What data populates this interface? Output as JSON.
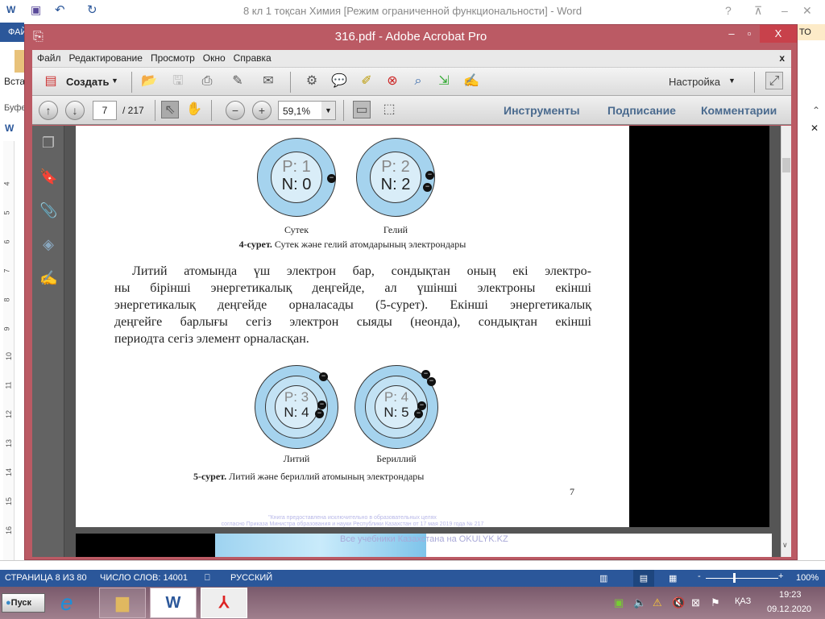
{
  "word": {
    "title": "8 кл 1 тоқсан Химия [Режим ограниченной функциональности] - Word",
    "file_tab": "ФАЙЛ",
    "insert_partial": "Вста",
    "buffer_partial": "Буфе",
    "right_partial": "ТО",
    "help": "?",
    "ruler": [
      "4",
      "5",
      "6",
      "7",
      "8",
      "9",
      "10",
      "11",
      "12",
      "13",
      "14",
      "15",
      "16"
    ]
  },
  "acrobat": {
    "title": "316.pdf - Adobe Acrobat Pro",
    "menu": [
      "Файл",
      "Редактирование",
      "Просмотр",
      "Окно",
      "Справка"
    ],
    "create_label": "Создать",
    "customize_label": "Настройка",
    "page_current": "7",
    "page_total": "/ 217",
    "zoom": "59,1%",
    "panels": [
      "Инструменты",
      "Подписание",
      "Комментарии"
    ]
  },
  "pdf": {
    "top_atoms": [
      {
        "p": "P: 1",
        "n": "N: 0",
        "name": "Сутек"
      },
      {
        "p": "P: 2",
        "n": "N: 2",
        "name": "Гелий"
      }
    ],
    "caption4_bold": "4-сурет.",
    "caption4": " Сутек және гелий атомдарының электрондары",
    "paragraph": [
      "Литий атомында үш электрон бар, сондықтан оның екі электро-",
      "ны бірінші энергетикалық деңгейде, ал үшінші электроны екінші",
      "энергетикалық деңгейде орналасады (5-сурет). Екінші энергетикалық",
      "деңгейге барлығы сегіз электрон сыяды (неонда), сондықтан екінші",
      "периодта сегіз элемент орналасқан."
    ],
    "bottom_atoms": [
      {
        "p": "P: 3",
        "n": "N: 4",
        "name": "Литий"
      },
      {
        "p": "P: 4",
        "n": "N: 5",
        "name": "Бериллий"
      }
    ],
    "caption5_bold": "5-сурет.",
    "caption5": " Литий және бериллий атомының электрондары",
    "page_number": "7",
    "footer1": "\"Книга предоставлена исключительно в образовательных целях",
    "footer2": "согласно Приказа Министра образования и науки Республики Казахстан от 17 мая 2019 года № 217",
    "next_banner": "Все учебники Казахстана на OKULYK.KZ"
  },
  "status": {
    "page": "СТРАНИЦА 8 ИЗ 80",
    "words": "ЧИСЛО СЛОВ: 14001",
    "lang": "РУССКИЙ",
    "zoom": "100%",
    "zoom_fraction": 0.5
  },
  "taskbar": {
    "start": "Пуск",
    "lang": "ҚАЗ",
    "time": "19:23",
    "date": "09.12.2020"
  }
}
